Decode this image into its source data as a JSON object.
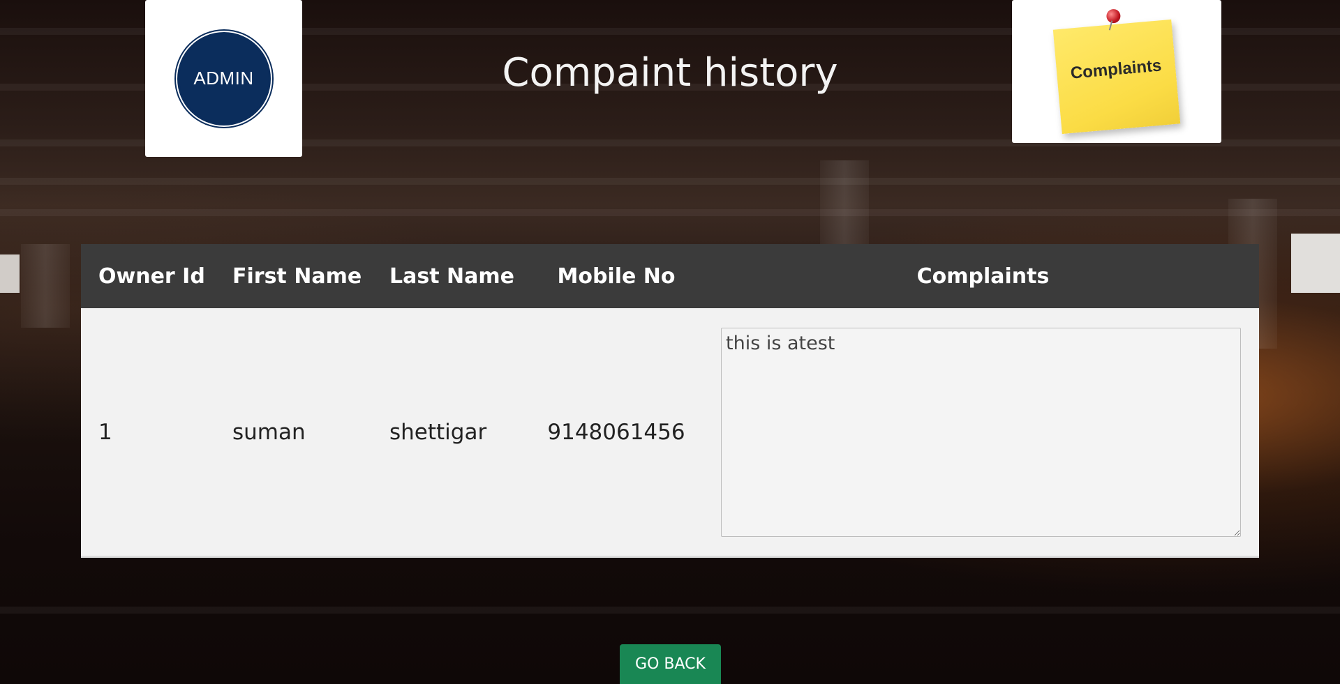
{
  "header": {
    "title": "Compaint history",
    "admin_logo_text": "ADMIN",
    "complaints_logo_text": "Complaints"
  },
  "table": {
    "headers": [
      "Owner Id",
      "First Name",
      "Last Name",
      "Mobile No",
      "Complaints"
    ],
    "rows": [
      {
        "owner_id": "1",
        "first_name": "suman",
        "last_name": "shettigar",
        "mobile_no": "9148061456",
        "complaint": "this is atest"
      }
    ]
  },
  "actions": {
    "go_back_label": "GO BACK"
  },
  "colors": {
    "header_bg": "#3b3b3b",
    "row_bg": "#f2f2f2",
    "button_bg": "#198754",
    "admin_badge": "#0b2d5c",
    "sticky_note": "#fbdc45"
  },
  "icons": {
    "admin_logo": "admin-badge-icon",
    "complaints_logo": "sticky-note-icon"
  }
}
